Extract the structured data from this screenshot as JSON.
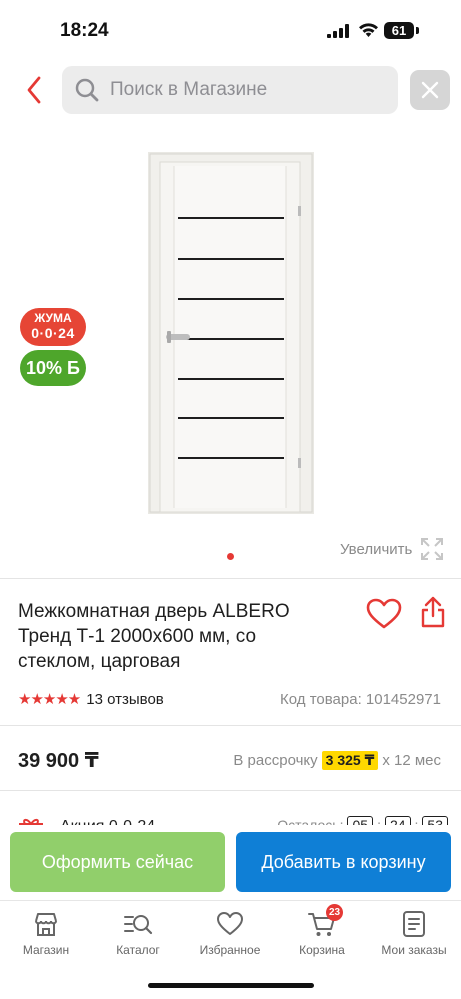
{
  "status_bar": {
    "time": "18:24",
    "battery": "61"
  },
  "search": {
    "placeholder": "Поиск в Магазине"
  },
  "gallery": {
    "promo_badge_title": "ЖУМА",
    "promo_badge_digits": "0·0·24",
    "bonus_badge": "10% Б",
    "zoom_label": "Увеличить",
    "active_dot": 1
  },
  "product": {
    "title": "Межкомнатная дверь ALBERO Тренд Т-1 2000x600 мм, со стеклом, царговая",
    "rating": 5,
    "reviews": "13 отзывов",
    "code": "Код товара: 101452971",
    "price": "39 900 ₸",
    "installment_prefix": "В рассрочку",
    "installment_amount": "3 325 ₸",
    "installment_suffix": "x 12 мес"
  },
  "promo": {
    "label": "Акция 0·0·24",
    "timer_label": "Осталось:",
    "timer": [
      "05",
      "24",
      "53"
    ]
  },
  "actions": {
    "checkout": "Оформить сейчас",
    "add_to_cart": "Добавить в корзину"
  },
  "tabs": [
    {
      "label": "Магазин",
      "icon": "shop-icon"
    },
    {
      "label": "Каталог",
      "icon": "catalog-search-icon"
    },
    {
      "label": "Избранное",
      "icon": "heart-icon"
    },
    {
      "label": "Корзина",
      "icon": "cart-icon",
      "badge": "23"
    },
    {
      "label": "Мои заказы",
      "icon": "orders-icon"
    }
  ],
  "colors": {
    "accent_red": "#e53935",
    "checkout_green": "#91cf6b",
    "cart_blue": "#0f7fd6",
    "installment_yellow": "#ffd800"
  }
}
